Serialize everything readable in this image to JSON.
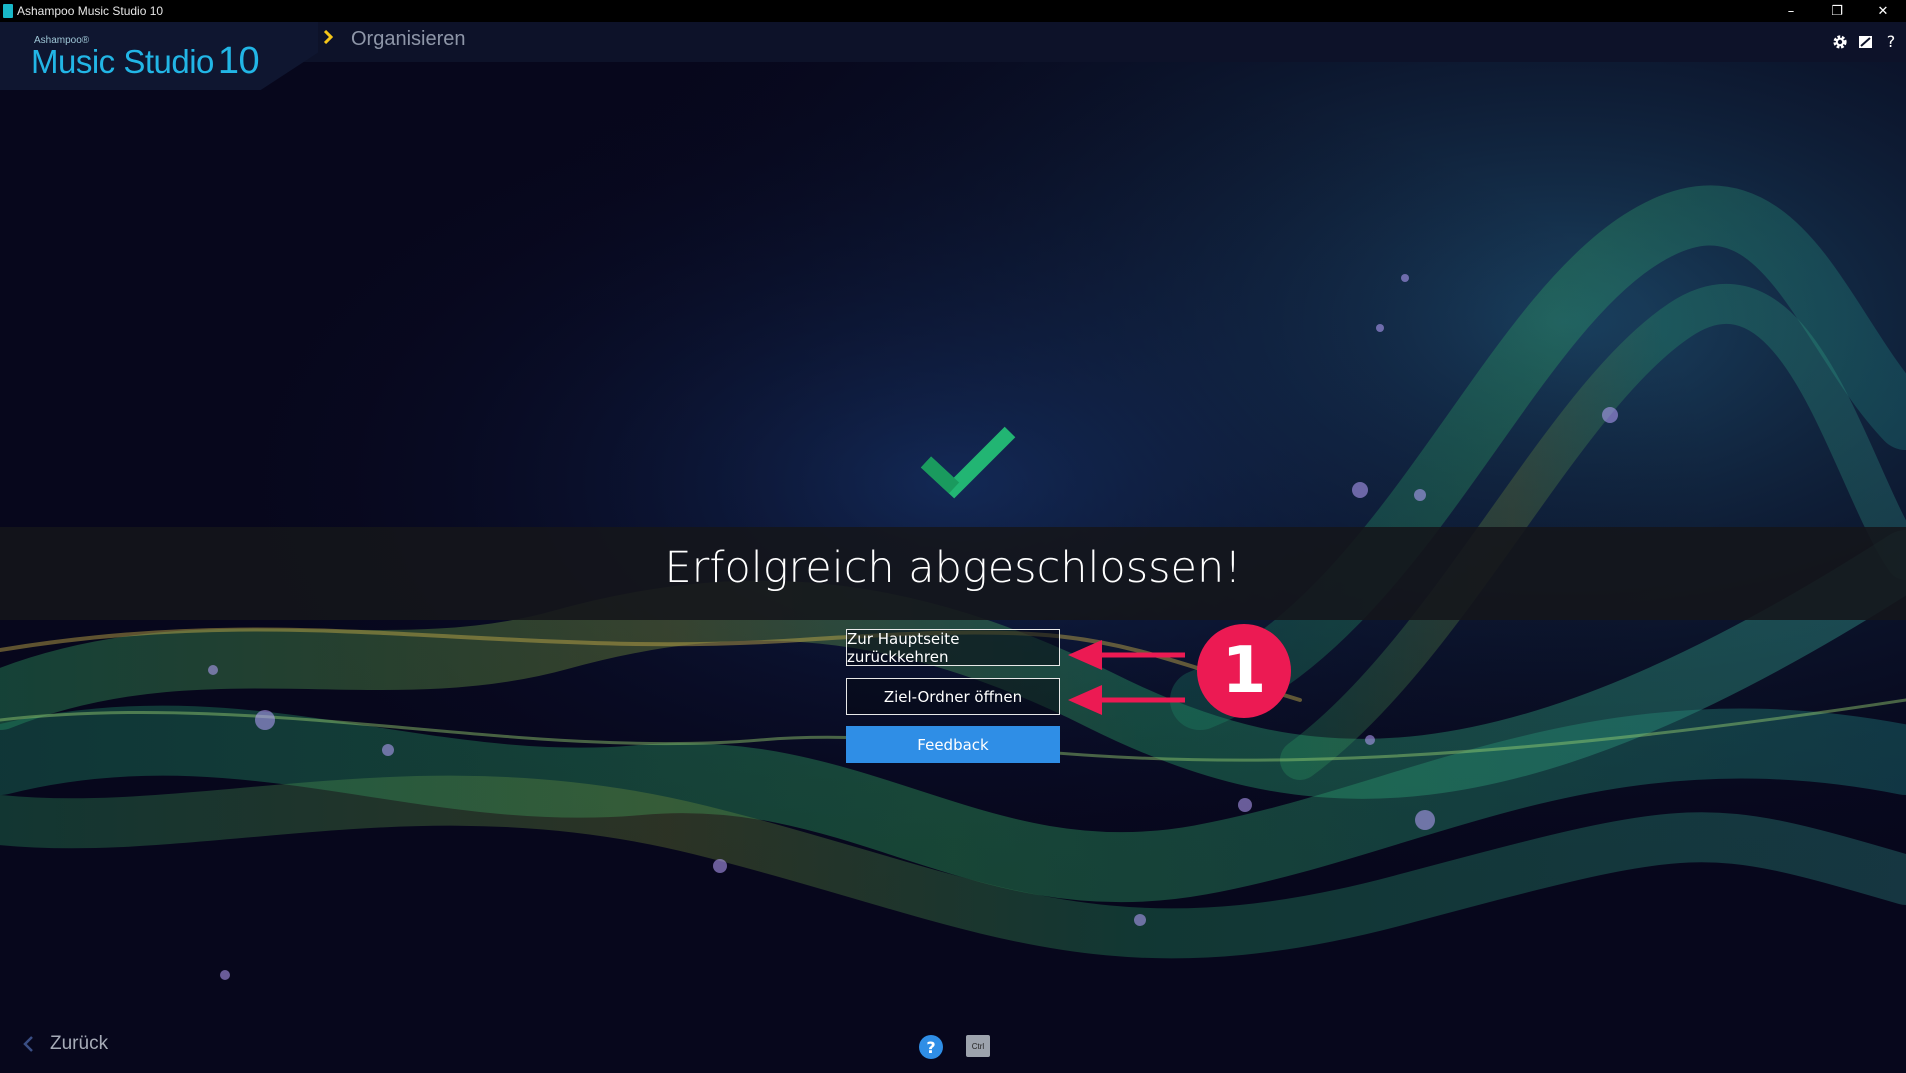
{
  "window": {
    "title": "Ashampoo Music Studio 10",
    "controls": {
      "minimize": "–",
      "restore": "❐",
      "close": "✕"
    }
  },
  "header": {
    "logo_small": "Ashampoo®",
    "logo_main": "Music Studio",
    "logo_version": "10",
    "breadcrumb": "Organisieren",
    "icons": [
      "gear-icon",
      "notes-icon",
      "help-icon"
    ],
    "help_glyph": "?"
  },
  "main": {
    "status_icon": "checkmark-icon",
    "result_message": "Erfolgreich abgeschlossen!",
    "buttons": {
      "home": "Zur Hauptseite zurückkehren",
      "open_folder": "Ziel-Ordner öffnen",
      "feedback": "Feedback"
    }
  },
  "annotation": {
    "badge_number": "1"
  },
  "footer": {
    "back_label": "Zurück",
    "help_glyph": "?",
    "ctrl_label": "Ctrl"
  },
  "colors": {
    "accent_blue": "#2f8ee6",
    "logo_blue": "#22b6e6",
    "check_green": "#22b573",
    "annotation_red": "#ec1a53",
    "breadcrumb_chevron": "#f5c518"
  }
}
